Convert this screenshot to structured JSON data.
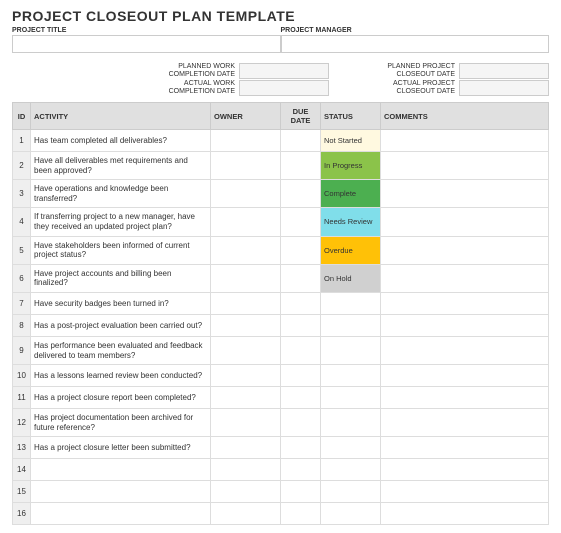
{
  "title": "PROJECT CLOSEOUT PLAN TEMPLATE",
  "top": {
    "project_title_label": "PROJECT TITLE",
    "project_title_value": "",
    "project_manager_label": "PROJECT MANAGER",
    "project_manager_value": ""
  },
  "dates": {
    "planned_work_label": "PLANNED WORK COMPLETION DATE",
    "planned_work_value": "",
    "actual_work_label": "ACTUAL WORK COMPLETION DATE",
    "actual_work_value": "",
    "planned_closeout_label": "PLANNED PROJECT CLOSEOUT DATE",
    "planned_closeout_value": "",
    "actual_closeout_label": "ACTUAL PROJECT CLOSEOUT DATE",
    "actual_closeout_value": ""
  },
  "headers": {
    "id": "ID",
    "activity": "ACTIVITY",
    "owner": "OWNER",
    "due": "DUE DATE",
    "status": "STATUS",
    "comments": "COMMENTS"
  },
  "rows": [
    {
      "id": "1",
      "activity": "Has team completed all deliverables?",
      "owner": "",
      "due": "",
      "status": "Not Started",
      "status_class": "s-notstarted",
      "comments": ""
    },
    {
      "id": "2",
      "activity": "Have all deliverables met requirements and been approved?",
      "owner": "",
      "due": "",
      "status": "In Progress",
      "status_class": "s-inprogress",
      "comments": ""
    },
    {
      "id": "3",
      "activity": "Have operations and knowledge been transferred?",
      "owner": "",
      "due": "",
      "status": "Complete",
      "status_class": "s-complete",
      "comments": ""
    },
    {
      "id": "4",
      "activity": "If transferring project to a new manager, have they received an updated project plan?",
      "owner": "",
      "due": "",
      "status": "Needs Review",
      "status_class": "s-needsreview",
      "comments": ""
    },
    {
      "id": "5",
      "activity": "Have stakeholders been informed of current project status?",
      "owner": "",
      "due": "",
      "status": "Overdue",
      "status_class": "s-overdue",
      "comments": ""
    },
    {
      "id": "6",
      "activity": "Have project accounts and billing been finalized?",
      "owner": "",
      "due": "",
      "status": "On Hold",
      "status_class": "s-onhold",
      "comments": ""
    },
    {
      "id": "7",
      "activity": "Have security badges been turned in?",
      "owner": "",
      "due": "",
      "status": "",
      "status_class": "",
      "comments": ""
    },
    {
      "id": "8",
      "activity": "Has a post-project evaluation been carried out?",
      "owner": "",
      "due": "",
      "status": "",
      "status_class": "",
      "comments": ""
    },
    {
      "id": "9",
      "activity": "Has performance been evaluated and feedback delivered to team members?",
      "owner": "",
      "due": "",
      "status": "",
      "status_class": "",
      "comments": ""
    },
    {
      "id": "10",
      "activity": "Has a lessons learned review been conducted?",
      "owner": "",
      "due": "",
      "status": "",
      "status_class": "",
      "comments": ""
    },
    {
      "id": "11",
      "activity": "Has a project closure report been completed?",
      "owner": "",
      "due": "",
      "status": "",
      "status_class": "",
      "comments": ""
    },
    {
      "id": "12",
      "activity": "Has project documentation been archived for future reference?",
      "owner": "",
      "due": "",
      "status": "",
      "status_class": "",
      "comments": ""
    },
    {
      "id": "13",
      "activity": "Has a project closure letter been submitted?",
      "owner": "",
      "due": "",
      "status": "",
      "status_class": "",
      "comments": ""
    },
    {
      "id": "14",
      "activity": "",
      "owner": "",
      "due": "",
      "status": "",
      "status_class": "",
      "comments": ""
    },
    {
      "id": "15",
      "activity": "",
      "owner": "",
      "due": "",
      "status": "",
      "status_class": "",
      "comments": ""
    },
    {
      "id": "16",
      "activity": "",
      "owner": "",
      "due": "",
      "status": "",
      "status_class": "",
      "comments": ""
    }
  ]
}
